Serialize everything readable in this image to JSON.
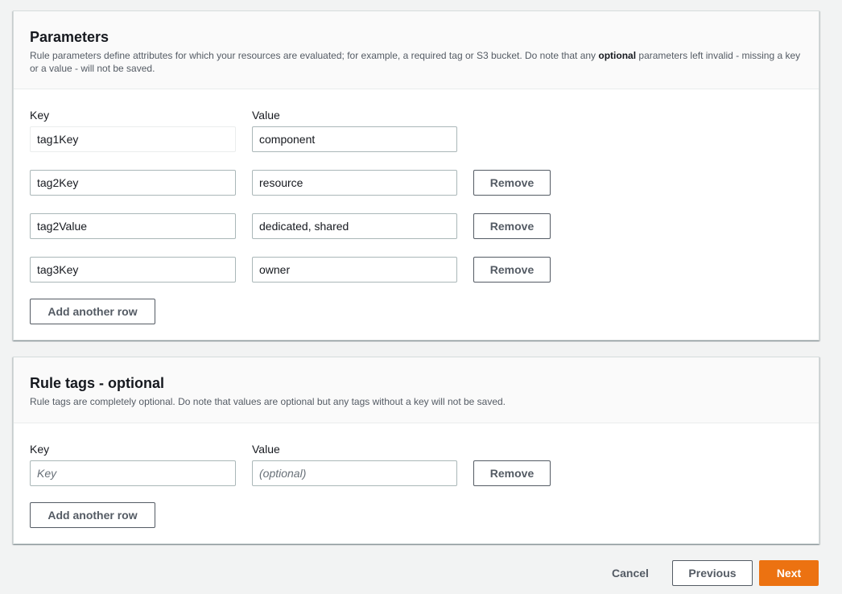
{
  "parameters": {
    "title": "Parameters",
    "desc_before": "Rule parameters define attributes for which your resources are evaluated; for example, a required tag or S3 bucket. Do note that any ",
    "desc_bold": "optional",
    "desc_after": " parameters left invalid - missing a key or a value - will not be saved.",
    "key_label": "Key",
    "value_label": "Value",
    "rows": [
      {
        "key": "tag1Key",
        "value": "component",
        "key_disabled": true,
        "removable": false
      },
      {
        "key": "tag2Key",
        "value": "resource",
        "removable": true
      },
      {
        "key": "tag2Value",
        "value": "dedicated, shared",
        "removable": true
      },
      {
        "key": "tag3Key",
        "value": "owner",
        "removable": true
      }
    ],
    "remove_label": "Remove",
    "add_row_label": "Add another row"
  },
  "rule_tags": {
    "title": "Rule tags - optional",
    "desc": "Rule tags are completely optional. Do note that values are optional but any tags without a key will not be saved.",
    "key_label": "Key",
    "value_label": "Value",
    "key_placeholder": "Key",
    "value_placeholder": "(optional)",
    "remove_label": "Remove",
    "add_row_label": "Add another row"
  },
  "footer": {
    "cancel_label": "Cancel",
    "previous_label": "Previous",
    "next_label": "Next"
  },
  "colors": {
    "primary": "#ec7211",
    "background": "#f2f3f3",
    "border": "#aab7b8"
  }
}
